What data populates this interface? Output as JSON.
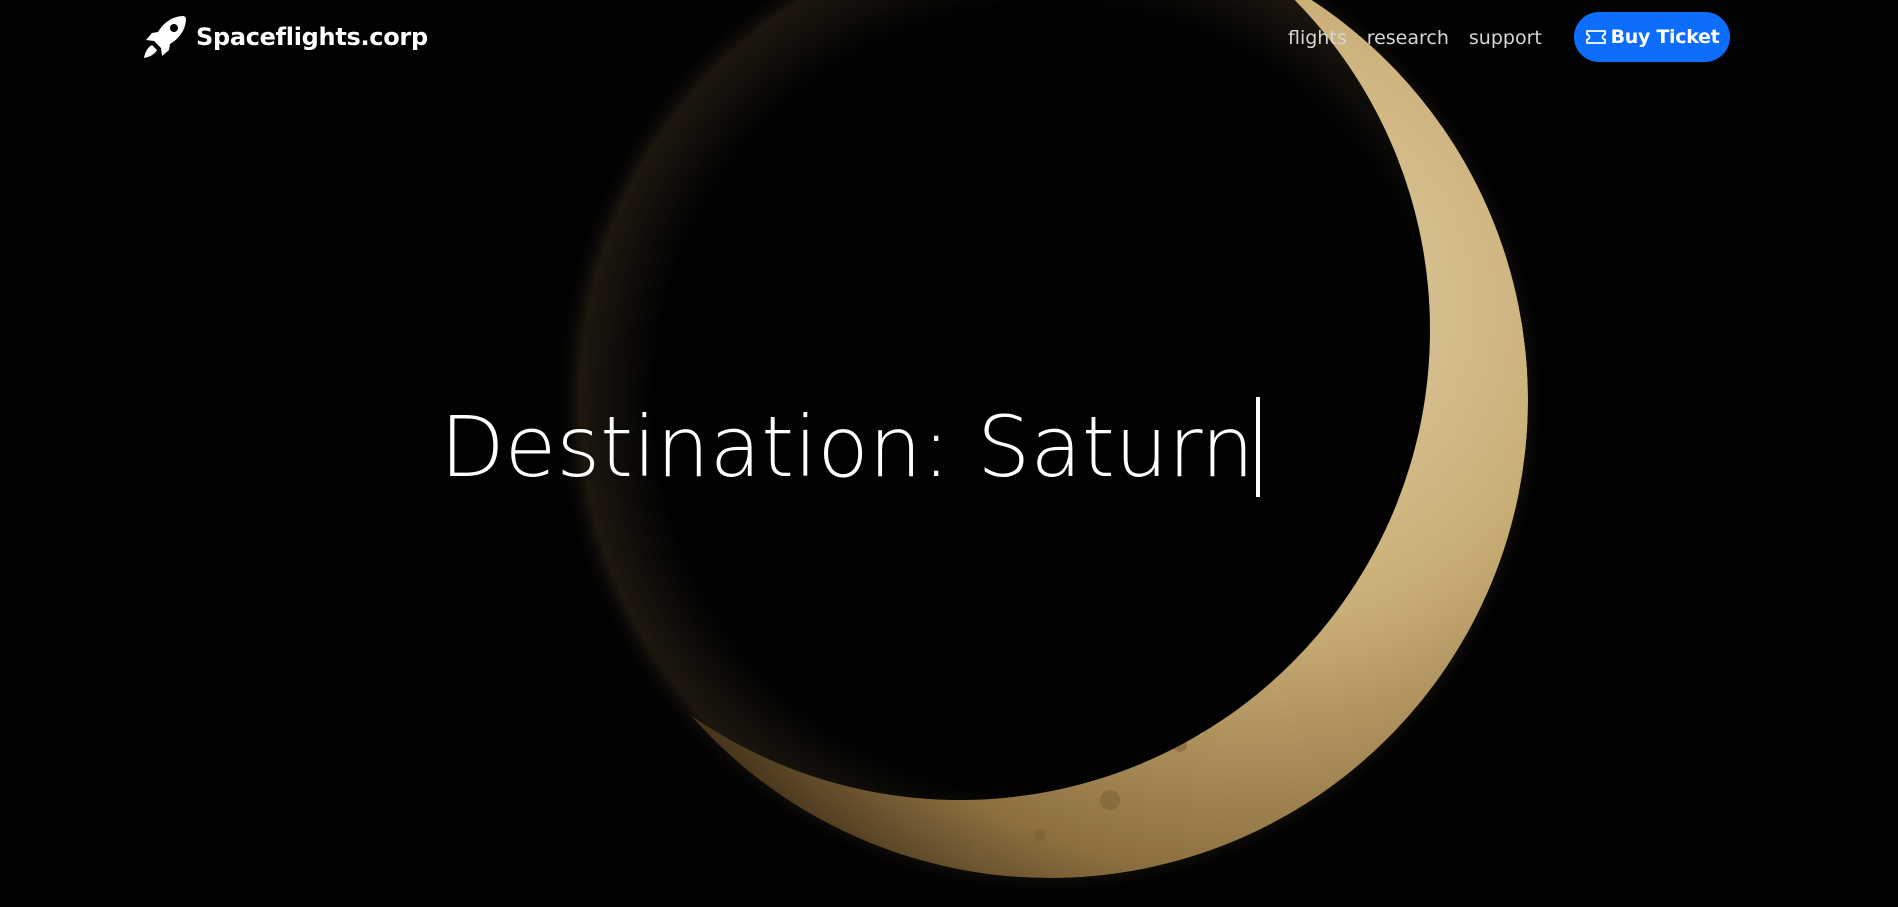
{
  "brand": {
    "name": "Spaceflights.corp",
    "logo_icon": "rocket-icon"
  },
  "nav": {
    "links": [
      "flights",
      "research",
      "support"
    ]
  },
  "cta": {
    "label": "Buy Ticket",
    "icon": "ticket-icon",
    "color": "#0d6efd"
  },
  "hero": {
    "text": "Destination: Saturn",
    "caret": "|"
  },
  "background": {
    "image": "crescent-moon",
    "color": "#020202"
  }
}
